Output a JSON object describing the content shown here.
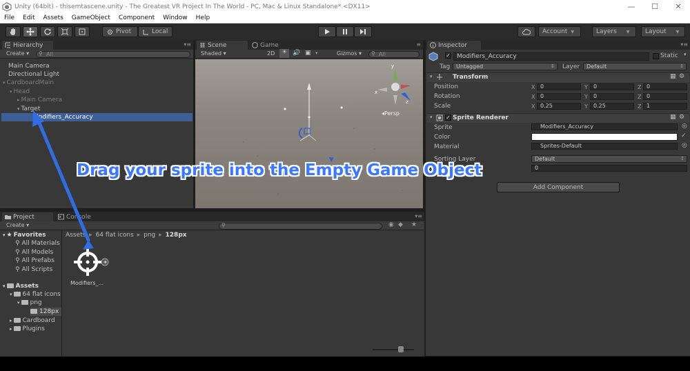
{
  "window": {
    "title": "Unity (64bit) - thisemtascene.unity - The Greatest VR Project In The World - PC, Mac & Linux Standalone* <DX11>",
    "minimize": "—",
    "maximize": "☐",
    "close": "✕"
  },
  "menu": [
    "File",
    "Edit",
    "Assets",
    "GameObject",
    "Component",
    "Window",
    "Help"
  ],
  "toolbar": {
    "pivot": "Pivot",
    "local": "Local",
    "account": "Account",
    "layers": "Layers",
    "layout": "Layout"
  },
  "hierarchy": {
    "tab": "Hierarchy",
    "create": "Create",
    "search": "All",
    "items": [
      {
        "label": "Main Camera"
      },
      {
        "label": "Directional Light"
      },
      {
        "label": "CardboardMain"
      },
      {
        "label": "Head"
      },
      {
        "label": "Main Camera"
      },
      {
        "label": "Target"
      },
      {
        "label": "Modifiers_Accuracy"
      }
    ]
  },
  "scene": {
    "tab_scene": "Scene",
    "tab_game": "Game",
    "shading": "Shaded",
    "mode_2d": "2D",
    "gizmos": "Gizmos",
    "search": "All",
    "persp": "Persp"
  },
  "overlay": {
    "instruction": "Drag your sprite into the Empty Game Object"
  },
  "inspector": {
    "tab": "Inspector",
    "object_name": "Modifiers_Accuracy",
    "static": "Static",
    "tag_label": "Tag",
    "tag_value": "Untagged",
    "layer_label": "Layer",
    "layer_value": "Default",
    "transform": {
      "title": "Transform",
      "position_label": "Position",
      "rotation_label": "Rotation",
      "scale_label": "Scale",
      "position": {
        "x": "0",
        "y": "0",
        "z": "0"
      },
      "rotation": {
        "x": "0",
        "y": "0",
        "z": "0"
      },
      "scale": {
        "x": "0.25",
        "y": "0.25",
        "z": "1"
      }
    },
    "axis_x": "X",
    "axis_y": "Y",
    "axis_z": "Z",
    "sprite_renderer": {
      "title": "Sprite Renderer",
      "sprite_label": "Sprite",
      "sprite_value": "Modifiers_Accuracy",
      "color_label": "Color",
      "material_label": "Material",
      "material_value": "Sprites-Default",
      "sorting_layer_label": "Sorting Layer",
      "sorting_layer_value": "Default",
      "order_value": "0"
    },
    "add_component": "Add Component"
  },
  "project": {
    "tab_project": "Project",
    "tab_console": "Console",
    "create": "Create",
    "favorites": {
      "title": "Favorites",
      "items": [
        "All Materials",
        "All Models",
        "All Prefabs",
        "All Scripts"
      ]
    },
    "assets": {
      "title": "Assets",
      "items": [
        "64 flat icons",
        "png",
        "128px",
        "Cardboard",
        "Plugins"
      ]
    },
    "breadcrumb": [
      "Assets",
      "64 flat icons",
      "png",
      "128px"
    ],
    "asset_label": "Modifiers_...",
    "sep": "▸"
  },
  "colors": {
    "accent": "#3a78ff",
    "selection": "#3e5f96",
    "panel": "#383838"
  }
}
